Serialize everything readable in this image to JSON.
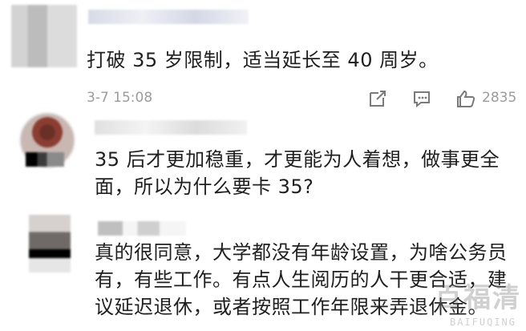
{
  "comments": [
    {
      "text": "打破 35 岁限制，适当延长至 40 周岁。",
      "time": "3-7 15:08",
      "likes": "2835"
    }
  ],
  "replies": [
    {
      "text_line1": "35 后才更加稳重，才更能为人着想，做事更全",
      "text_line2": "面，所以为什么要卡 35?"
    },
    {
      "text_line1": "真的很同意，大学都没有年龄设置，为啥公务员",
      "text_line2": "有，有些工作。有点人生阅历的人干更合适，建",
      "text_line3": "议延迟退休，或者按照工作年限来弄退休金。"
    }
  ],
  "icons": {
    "share": "share-icon",
    "reply": "reply-icon",
    "like": "like-icon"
  },
  "watermark": {
    "main": "百福清",
    "sub": "BAIFUQING"
  }
}
